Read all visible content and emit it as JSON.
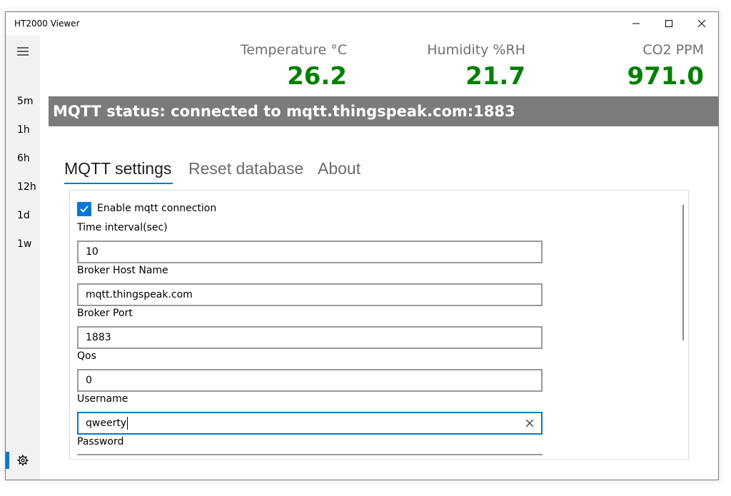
{
  "window": {
    "title": "HT2000 Viewer",
    "controls": {
      "minimize": "—",
      "maximize": "☐",
      "close": "✕"
    }
  },
  "sidebar": {
    "menu_icon": "hamburger-menu-icon",
    "ranges": [
      "5m",
      "1h",
      "6h",
      "12h",
      "1d",
      "1w"
    ],
    "settings_icon": "gear-icon",
    "accent": "#0078d7"
  },
  "readings": [
    {
      "label": "Temperature °C",
      "value": "26.2"
    },
    {
      "label": "Humidity %RH",
      "value": "21.7"
    },
    {
      "label": "CO2 PPM",
      "value": "971.0"
    }
  ],
  "reading_color": "#008000",
  "mqtt_status": "MQTT status: connected to mqtt.thingspeak.com:1883",
  "tabs": [
    {
      "label": "MQTT settings",
      "selected": true
    },
    {
      "label": "Reset database",
      "selected": false
    },
    {
      "label": "About",
      "selected": false
    }
  ],
  "settings": {
    "enable_label": "Enable mqtt connection",
    "enable_checked": true,
    "fields": [
      {
        "label": "Time interval(sec)",
        "value": "10"
      },
      {
        "label": "Broker Host Name",
        "value": "mqtt.thingspeak.com"
      },
      {
        "label": "Broker Port",
        "value": "1883"
      },
      {
        "label": "Qos",
        "value": "0"
      },
      {
        "label": "Username",
        "value": "qweerty",
        "focused": true
      },
      {
        "label": "Password",
        "value": ""
      }
    ]
  }
}
